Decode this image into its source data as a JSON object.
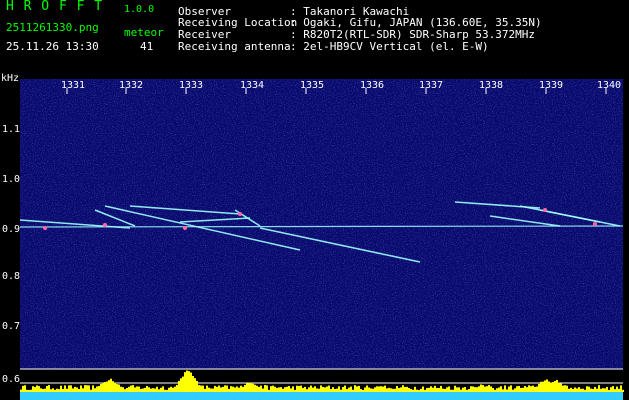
{
  "header": {
    "app_title": "H R O F F T",
    "version": "1.0.0",
    "filename": "2511261330.png",
    "datetime": "25.11.26 13:30",
    "meteor_label": "meteor",
    "meteor_count": "41",
    "info": [
      {
        "key": "Observer",
        "value": ": Takanori Kawachi"
      },
      {
        "key": "Receiving Location",
        "value": ": Ogaki, Gifu, JAPAN (136.60E, 35.35N)"
      },
      {
        "key": "Receiver",
        "value": ": R820T2(RTL-SDR) SDR-Sharp 53.372MHz"
      },
      {
        "key": "Receiving antenna",
        "value": ": 2el-HB9CV Vertical (el. E-W)"
      }
    ]
  },
  "plot": {
    "y_unit": "kHz",
    "y_ticks": [
      "1.1",
      "1.0",
      "0.9",
      "0.8",
      "0.7",
      "0.6"
    ],
    "x_ticks": [
      "1331",
      "1332",
      "1333",
      "1334",
      "1335",
      "1336",
      "1337",
      "1338",
      "1339",
      "1340"
    ],
    "colors": {
      "background": "#0a0a6e",
      "trace": "#9fffff",
      "meteor": "#ff66aa",
      "level": "#ffff00",
      "grid": "#ffffff"
    }
  }
}
